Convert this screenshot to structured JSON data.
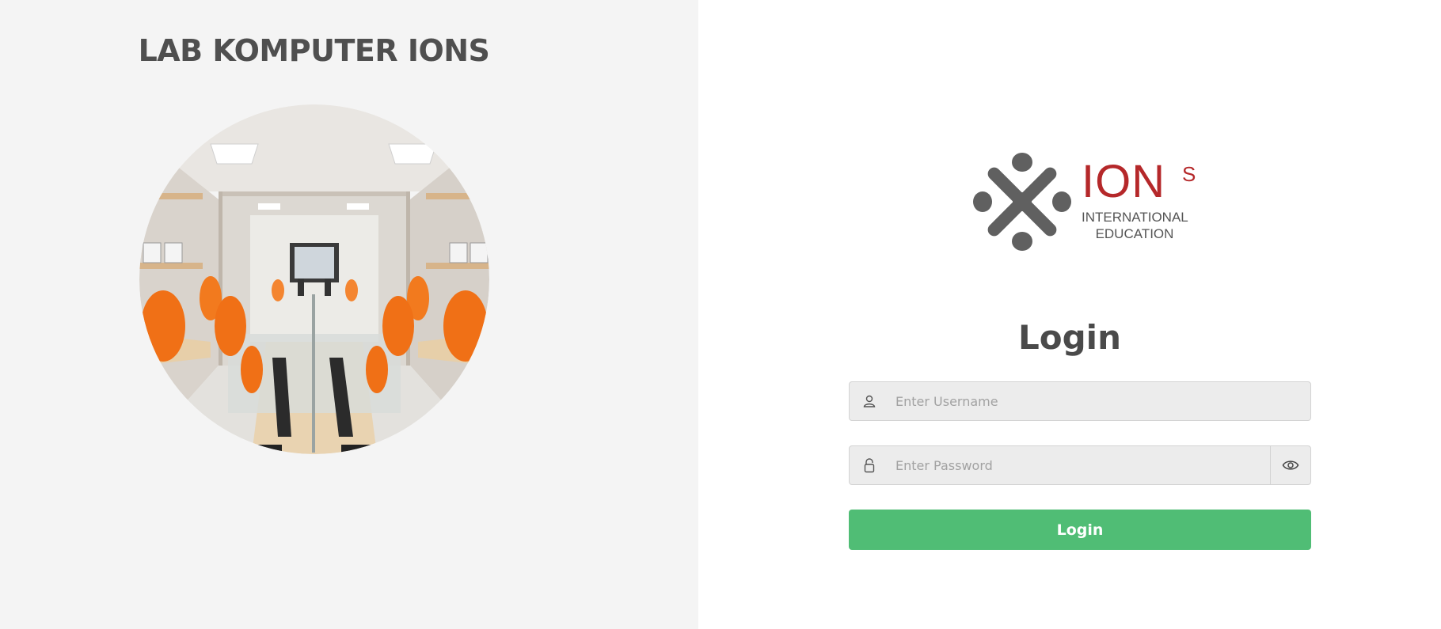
{
  "left_panel": {
    "title": "LAB KOMPUTER IONS",
    "photo_icon": "computer-lab-photo"
  },
  "logo": {
    "brand": "ION",
    "superscript": "S",
    "tagline_line1": "INTERNATIONAL",
    "tagline_line2": "EDUCATION",
    "brand_color": "#b5282a",
    "mark_color": "#606060"
  },
  "login": {
    "heading": "Login",
    "username": {
      "value": "",
      "placeholder": "Enter Username",
      "icon": "user-icon"
    },
    "password": {
      "value": "",
      "placeholder": "Enter Password",
      "icon": "lock-icon",
      "toggle_icon": "eye-icon"
    },
    "submit_label": "Login"
  },
  "colors": {
    "left_background": "#f4f4f4",
    "right_background": "#ffffff",
    "input_background": "#ececec",
    "button": "#50bd75",
    "heading_text": "#4a4a4a"
  }
}
